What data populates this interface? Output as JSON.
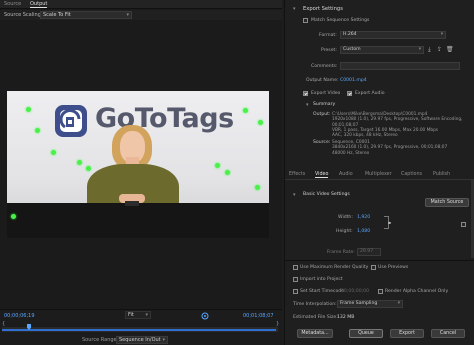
{
  "left": {
    "tabs": [
      "Source",
      "Output"
    ],
    "source_scaling_label": "Source Scaling",
    "source_scaling_value": "Scale To Fit",
    "timeline": {
      "current_tc": "00;00;06;19",
      "fit": "Fit",
      "end_tc": "00;01;08;07",
      "source_range_label": "Source Range",
      "source_range_value": "Sequence In/Out"
    },
    "preview": {
      "logo_text": "GoToTags"
    }
  },
  "right": {
    "export_settings": "Export Settings",
    "match_sequence": "Match Sequence Settings",
    "format_label": "Format:",
    "format_value": "H.264",
    "preset_label": "Preset:",
    "preset_value": "Custom",
    "comments_label": "Comments:",
    "output_name_label": "Output Name:",
    "output_name_value": "C0001.mp4",
    "export_video": "Export Video",
    "export_audio": "Export Audio",
    "summary_label": "Summary",
    "output_label": "Output:",
    "output_text": "C:\\Users\\Mike\\Bergsma\\Desktop\\C0001.mp4\n1920x1080 (1.0), 29.97 fps, Progressive, Software Encoding,\n00;01;08;07\nVBR, 1 pass, Target 16.00 Mbps, Max 20.00 Mbps\nAAC, 320 kbps, 48 kHz, Stereo",
    "source_label": "Source:",
    "source_text": "Sequence, C0001\n3840x2160 (1.0), 29.97 fps, Progressive, 00;01;08;07\n48000 Hz, Stereo",
    "tabs": [
      "Effects",
      "Video",
      "Audio",
      "Multiplexer",
      "Captions",
      "Publish"
    ],
    "basic_video": "Basic Video Settings",
    "match_source": "Match Source",
    "width_label": "Width:",
    "width_value": "1,920",
    "height_label": "Height:",
    "height_value": "1,080",
    "frame_rate_label": "Frame Rate:",
    "frame_rate_value": "29.97",
    "use_max_render": "Use Maximum Render Quality",
    "use_previews": "Use Previews",
    "import_into_project": "Import into Project",
    "set_start_timecode": "Set Start Timecode",
    "start_timecode_value": "00;00;00;00",
    "render_alpha": "Render Alpha Channel Only",
    "time_interp_label": "Time Interpolation:",
    "time_interp_value": "Frame Sampling",
    "file_size_label": "Estimated File Size:",
    "file_size_value": "132 MB",
    "buttons": {
      "metadata": "Metadata...",
      "queue": "Queue",
      "export": "Export",
      "cancel": "Cancel"
    }
  },
  "colors": {
    "accent": "#5aa7ff",
    "sweater": "#6d6a2e",
    "marker": "#4bf04b"
  }
}
